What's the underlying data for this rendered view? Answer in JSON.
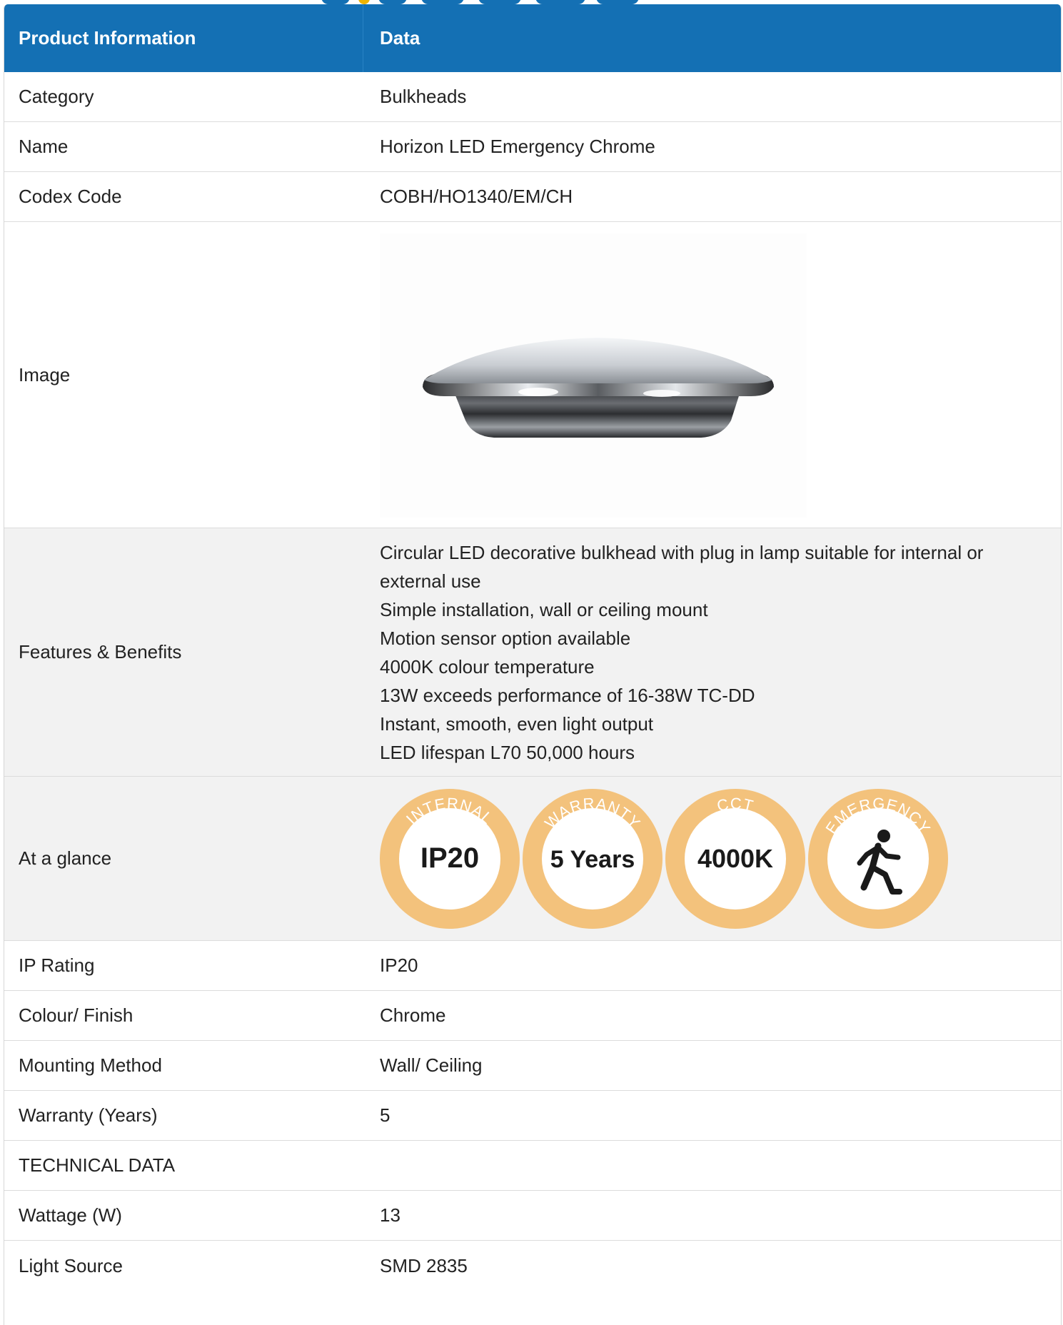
{
  "table": {
    "header": {
      "col1": "Product Information",
      "col2": "Data"
    },
    "rows": {
      "category": {
        "label": "Category",
        "value": "Bulkheads"
      },
      "name": {
        "label": "Name",
        "value": "Horizon LED Emergency Chrome"
      },
      "codex": {
        "label": "Codex Code",
        "value": "COBH/HO1340/EM/CH"
      },
      "image": {
        "label": "Image"
      },
      "features": {
        "label": "Features & Benefits",
        "items": [
          "Circular LED decorative bulkhead with plug in lamp suitable for internal or",
          "external use",
          "Simple installation, wall or ceiling mount",
          "Motion sensor option available",
          "4000K colour temperature",
          "13W exceeds performance of 16-38W TC-DD",
          "Instant, smooth, even light output",
          "LED lifespan L70 50,000 hours"
        ]
      },
      "glance": {
        "label": "At a glance",
        "badges": [
          {
            "arc": "INTERNAL",
            "center": "IP20"
          },
          {
            "arc": "WARRANTY",
            "center": "5 Years"
          },
          {
            "arc": "CCT",
            "center": "4000K"
          },
          {
            "arc": "EMERGENCY",
            "icon": "running-man-icon"
          }
        ]
      },
      "ip": {
        "label": "IP Rating",
        "value": "IP20"
      },
      "colour": {
        "label": "Colour/ Finish",
        "value": "Chrome"
      },
      "mounting": {
        "label": "Mounting Method",
        "value": "Wall/ Ceiling"
      },
      "warranty": {
        "label": "Warranty (Years)",
        "value": "5"
      },
      "technical": {
        "label": "TECHNICAL DATA"
      },
      "wattage": {
        "label": "Wattage (W)",
        "value": "13"
      },
      "source": {
        "label": "Light Source",
        "value": "SMD 2835"
      }
    }
  },
  "colors": {
    "header_bg": "#1470b4",
    "badge_ring": "#f3c27c",
    "stripe_bg": "#f2f2f2"
  }
}
